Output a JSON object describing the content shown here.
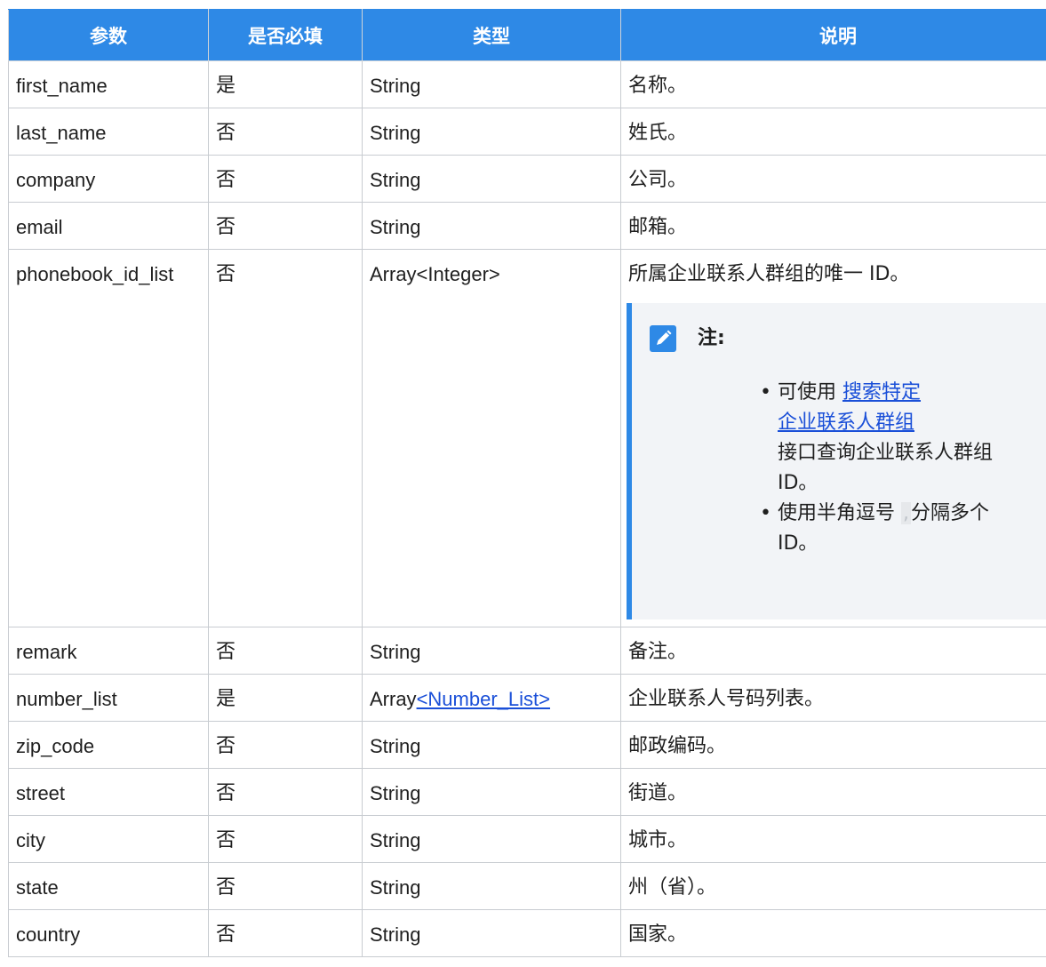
{
  "table": {
    "headers": [
      "参数",
      "是否必填",
      "类型",
      "说明"
    ],
    "rows": [
      {
        "param": "first_name",
        "required": "是",
        "type": "String",
        "desc": "名称。"
      },
      {
        "param": "last_name",
        "required": "否",
        "type": "String",
        "desc": "姓氏。"
      },
      {
        "param": "company",
        "required": "否",
        "type": "String",
        "desc": "公司。"
      },
      {
        "param": "email",
        "required": "否",
        "type": "String",
        "desc": "邮箱。"
      },
      {
        "param": "phonebook_id_list",
        "required": "否",
        "type": "Array<Integer>",
        "desc": "所属企业联系人群组的唯一 ID。"
      },
      {
        "param": "remark",
        "required": "否",
        "type": "String",
        "desc": "备注。"
      },
      {
        "param": "number_list",
        "required": "是",
        "type_prefix": "Array",
        "type_link": "<Number_List>",
        "desc": "企业联系人号码列表。"
      },
      {
        "param": "zip_code",
        "required": "否",
        "type": "String",
        "desc": "邮政编码。"
      },
      {
        "param": "street",
        "required": "否",
        "type": "String",
        "desc": "街道。"
      },
      {
        "param": "city",
        "required": "否",
        "type": "String",
        "desc": "城市。"
      },
      {
        "param": "state",
        "required": "否",
        "type": "String",
        "desc": "州（省）。"
      },
      {
        "param": "country",
        "required": "否",
        "type": "String",
        "desc": "国家。"
      }
    ]
  },
  "note": {
    "title": "注:",
    "icon": "edit-note-icon",
    "item1_prefix": "可使用 ",
    "item1_link_line1": "搜索特定",
    "item1_link_line2": "企业联系人群组",
    "item1_suffix_line1": "接口查询企业联系人群组",
    "item1_suffix_line2": "ID。",
    "item2_line1": "使用半角逗号",
    "item2_comma": ",",
    "item2_line1_end": "分隔多个",
    "item2_line2": "ID。",
    "bullet": "•"
  },
  "colors": {
    "header_bg": "#2e89e6",
    "link": "#1a4fd8",
    "note_bg": "#f2f4f7",
    "note_accent": "#2e89e6"
  }
}
